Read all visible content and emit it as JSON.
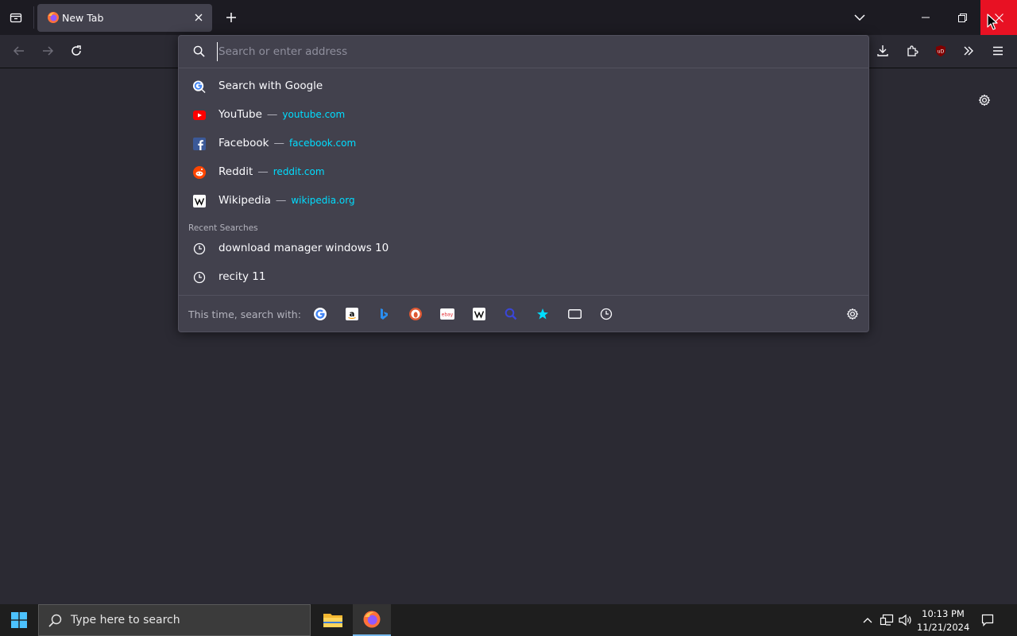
{
  "tab": {
    "title": "New Tab"
  },
  "urlbar": {
    "placeholder": "Search or enter address",
    "search_with_google": "Search with Google",
    "shortcuts": [
      {
        "name": "YouTube",
        "url": "youtube.com"
      },
      {
        "name": "Facebook",
        "url": "facebook.com"
      },
      {
        "name": "Reddit",
        "url": "reddit.com"
      },
      {
        "name": "Wikipedia",
        "url": "wikipedia.org"
      }
    ],
    "recent_header": "Recent Searches",
    "recent": [
      "download manager windows 10",
      "recity 11"
    ],
    "one_off_label": "This time, search with:",
    "dash": "—"
  },
  "taskbar": {
    "search_placeholder": "Type here to search",
    "time": "10:13 PM",
    "date": "11/21/2024"
  },
  "colors": {
    "tab_strip": "#1c1b22",
    "toolbar": "#2b2a33",
    "popup": "#42414d",
    "link": "#00ddff",
    "close_hover": "#e81123"
  }
}
